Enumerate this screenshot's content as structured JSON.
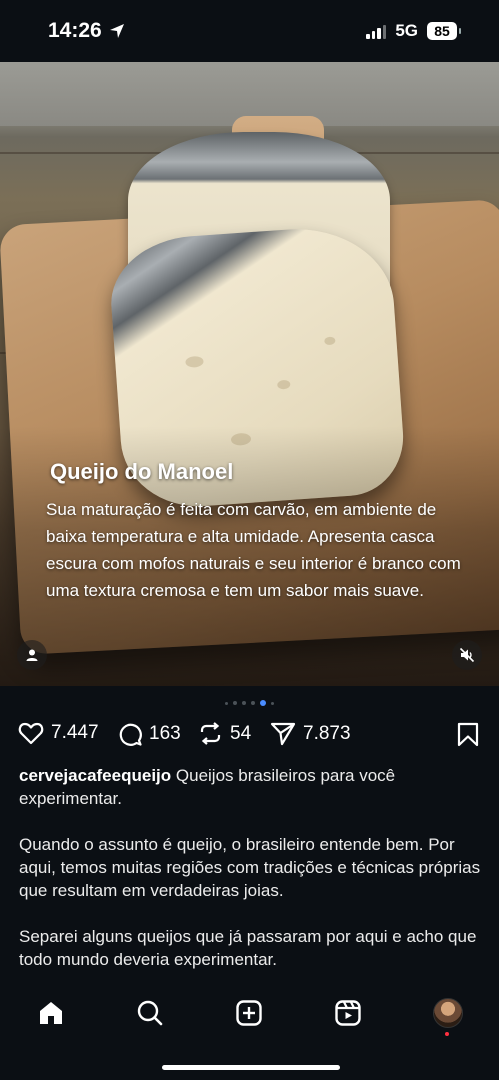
{
  "status_bar": {
    "time": "14:26",
    "network": "5G",
    "battery": "85"
  },
  "post": {
    "image_alt_icon": "cheese-photo",
    "caption_title": "Queijo do Manoel",
    "caption_body": "Sua maturação é feita com carvão, em ambiente de baixa temperatura e alta umidade. Apresenta casca escura com mofos naturais e seu interior é branco com uma textura cremosa e tem um sabor mais suave.",
    "carousel": {
      "total_dots": 6,
      "active_index": 4
    }
  },
  "actions": {
    "likes": "7.447",
    "comments": "163",
    "reposts": "54",
    "shares": "7.873"
  },
  "description": {
    "username": "cervejacafeequeijo",
    "paragraph1": "Queijos brasileiros para você experimentar.",
    "paragraph2": "Quando o assunto é queijo, o brasileiro entende bem. Por aqui, temos muitas regiões com tradições e técnicas próprias que resultam em verdadeiras joias.",
    "paragraph3": "Separei alguns queijos que já passaram por aqui e acho que todo mundo deveria experimentar."
  },
  "nav": [
    "home-icon",
    "search-icon",
    "create-icon",
    "reels-icon",
    "profile-avatar"
  ],
  "colors": {
    "background": "#0b0f14",
    "active_dot": "#4a8cff",
    "notification": "#ff3040"
  }
}
